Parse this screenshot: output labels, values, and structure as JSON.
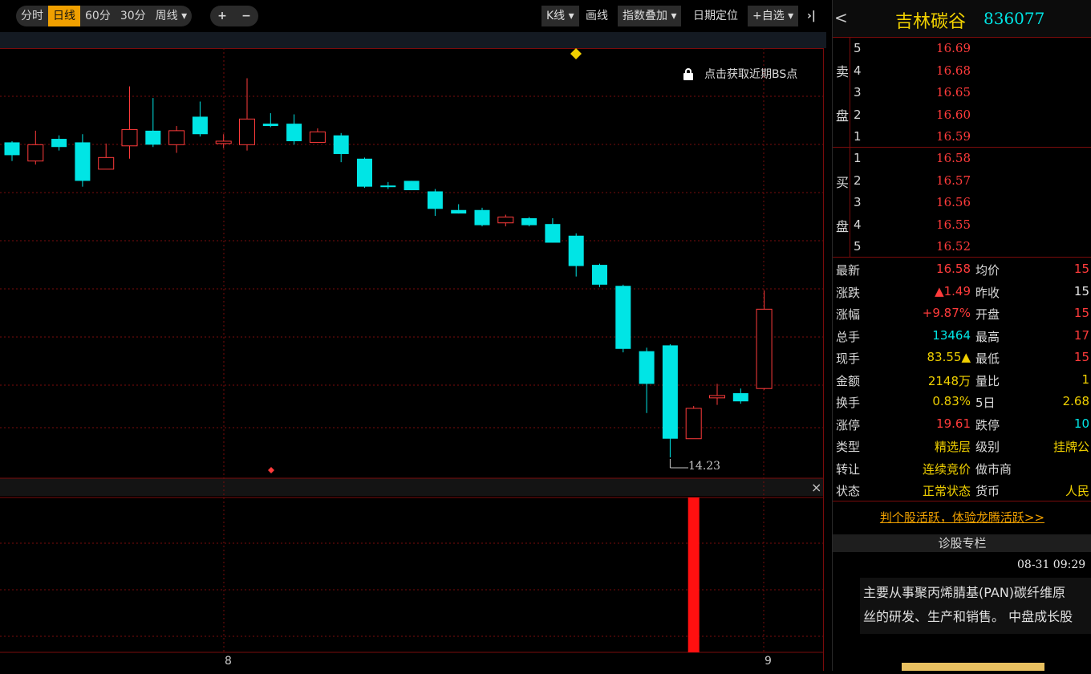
{
  "toolbar": {
    "periods": [
      "分时",
      "日线",
      "60分",
      "30分",
      "周线 ▾"
    ],
    "active_period": "日线",
    "zoom_in": "+",
    "zoom_out": "−",
    "kline_menu": "K线 ▾",
    "draw": "画线",
    "index_overlay": "指数叠加 ▾",
    "date_locate": "日期定位",
    "add_watch": "+自选 ▾",
    "collapse": "›|"
  },
  "chart": {
    "bs_hint": "点击获取近期BS点",
    "low_label": "14.23",
    "date_ticks": [
      "8",
      "9"
    ],
    "close_sub": "×"
  },
  "stock": {
    "name": "吉林碳谷",
    "code": "836077",
    "back": "<"
  },
  "orderbook": {
    "sell_labels": [
      "卖",
      "盘"
    ],
    "buy_labels": [
      "买",
      "盘"
    ],
    "sell": [
      {
        "level": "5",
        "price": "16.69"
      },
      {
        "level": "4",
        "price": "16.68"
      },
      {
        "level": "3",
        "price": "16.65"
      },
      {
        "level": "2",
        "price": "16.60"
      },
      {
        "level": "1",
        "price": "16.59"
      }
    ],
    "buy": [
      {
        "level": "1",
        "price": "16.58"
      },
      {
        "level": "2",
        "price": "16.57"
      },
      {
        "level": "3",
        "price": "16.56"
      },
      {
        "level": "4",
        "price": "16.55"
      },
      {
        "level": "5",
        "price": "16.52"
      }
    ]
  },
  "quote": [
    {
      "k1": "最新",
      "v1": "16.58",
      "c1": "red",
      "k2": "均价",
      "v2": "15",
      "c2": "red"
    },
    {
      "k1": "涨跌",
      "v1": "▲1.49",
      "c1": "red",
      "k2": "昨收",
      "v2": "15",
      "c2": "white"
    },
    {
      "k1": "涨幅",
      "v1": "+9.87%",
      "c1": "red",
      "k2": "开盘",
      "v2": "15",
      "c2": "red"
    },
    {
      "k1": "总手",
      "v1": "13464",
      "c1": "cyan",
      "k2": "最高",
      "v2": "17",
      "c2": "red"
    },
    {
      "k1": "现手",
      "v1": "83.55▲",
      "c1": "yellow",
      "k2": "最低",
      "v2": "15",
      "c2": "red"
    },
    {
      "k1": "金额",
      "v1": "2148万",
      "c1": "yellow",
      "k2": "量比",
      "v2": "1",
      "c2": "yellow"
    },
    {
      "k1": "换手",
      "v1": "0.83%",
      "c1": "yellow",
      "k2": "5日",
      "v2": "2.68",
      "c2": "yellow"
    },
    {
      "k1": "涨停",
      "v1": "19.61",
      "c1": "red",
      "k2": "跌停",
      "v2": "10",
      "c2": "cyan"
    },
    {
      "k1": "类型",
      "v1": "精选层",
      "c1": "yellow",
      "k2": "级别",
      "v2": "挂牌公",
      "c2": "yellow"
    },
    {
      "k1": "转让",
      "v1": "连续竞价",
      "c1": "yellow",
      "k2": "做市商",
      "v2": "",
      "c2": "yellow"
    },
    {
      "k1": "状态",
      "v1": "正常状态",
      "c1": "yellow",
      "k2": "货币",
      "v2": "人民",
      "c2": "yellow"
    }
  ],
  "promo": "判个股活跃，体验龙腾活跃>>",
  "diag": {
    "title": "诊股专栏",
    "time": "08-31 09:29",
    "text_line1": "主要从事聚丙烯腈基(PAN)碳纤维原",
    "text_line2": "丝的研发、生产和销售。 中盘成长股"
  },
  "colors": {
    "up": "#ff3b3b",
    "down": "#00e5e5",
    "grid": "#7a0b0b",
    "accent": "#f0a000"
  },
  "chart_data": {
    "type": "candlestick",
    "series": [
      {
        "open": 18.72,
        "close": 18.61,
        "high": 18.73,
        "low": 18.56
      },
      {
        "open": 18.56,
        "close": 18.7,
        "high": 18.82,
        "low": 18.53
      },
      {
        "open": 18.75,
        "close": 18.68,
        "high": 18.78,
        "low": 18.65
      },
      {
        "open": 18.72,
        "close": 18.39,
        "high": 18.79,
        "low": 18.34
      },
      {
        "open": 18.49,
        "close": 18.59,
        "high": 18.71,
        "low": 18.49
      },
      {
        "open": 18.69,
        "close": 18.83,
        "high": 19.2,
        "low": 18.58
      },
      {
        "open": 18.82,
        "close": 18.7,
        "high": 19.1,
        "low": 18.68
      },
      {
        "open": 18.7,
        "close": 18.82,
        "high": 18.86,
        "low": 18.63
      },
      {
        "open": 18.94,
        "close": 18.79,
        "high": 19.07,
        "low": 18.77
      },
      {
        "open": 18.71,
        "close": 18.73,
        "high": 18.79,
        "low": 18.67
      },
      {
        "open": 18.7,
        "close": 18.92,
        "high": 19.27,
        "low": 18.65
      },
      {
        "open": 18.88,
        "close": 18.86,
        "high": 18.97,
        "low": 18.85
      },
      {
        "open": 18.88,
        "close": 18.73,
        "high": 18.96,
        "low": 18.7
      },
      {
        "open": 18.72,
        "close": 18.81,
        "high": 18.84,
        "low": 18.72
      },
      {
        "open": 18.78,
        "close": 18.62,
        "high": 18.8,
        "low": 18.55
      },
      {
        "open": 18.58,
        "close": 18.34,
        "high": 18.59,
        "low": 18.33
      },
      {
        "open": 18.35,
        "close": 18.34,
        "high": 18.38,
        "low": 18.32
      },
      {
        "open": 18.39,
        "close": 18.31,
        "high": 18.39,
        "low": 18.31
      },
      {
        "open": 18.3,
        "close": 18.15,
        "high": 18.32,
        "low": 18.09
      },
      {
        "open": 18.14,
        "close": 18.11,
        "high": 18.19,
        "low": 18.11
      },
      {
        "open": 18.14,
        "close": 18.01,
        "high": 18.16,
        "low": 18.0
      },
      {
        "open": 18.03,
        "close": 18.08,
        "high": 18.1,
        "low": 18.0
      },
      {
        "open": 18.07,
        "close": 18.01,
        "high": 18.08,
        "low": 18.0
      },
      {
        "open": 18.02,
        "close": 17.86,
        "high": 18.07,
        "low": 17.86
      },
      {
        "open": 17.92,
        "close": 17.66,
        "high": 17.94,
        "low": 17.57
      },
      {
        "open": 17.67,
        "close": 17.5,
        "high": 17.68,
        "low": 17.48
      },
      {
        "open": 17.49,
        "close": 16.95,
        "high": 17.5,
        "low": 16.92
      },
      {
        "open": 16.93,
        "close": 16.65,
        "high": 16.96,
        "low": 16.4
      },
      {
        "open": 16.98,
        "close": 16.18,
        "high": 16.99,
        "low": 16.02
      },
      {
        "open": 16.18,
        "close": 16.44,
        "high": 16.46,
        "low": 16.18
      },
      {
        "open": 16.53,
        "close": 16.55,
        "high": 16.65,
        "low": 16.47
      },
      {
        "open": 16.57,
        "close": 16.5,
        "high": 16.61,
        "low": 16.48
      },
      {
        "open": 16.61,
        "close": 17.29,
        "high": 17.45,
        "low": 16.6
      }
    ],
    "ylim": [
      16.02,
      19.39
    ],
    "low_marker": 14.23,
    "volume_last_nonzero_index": 29
  }
}
